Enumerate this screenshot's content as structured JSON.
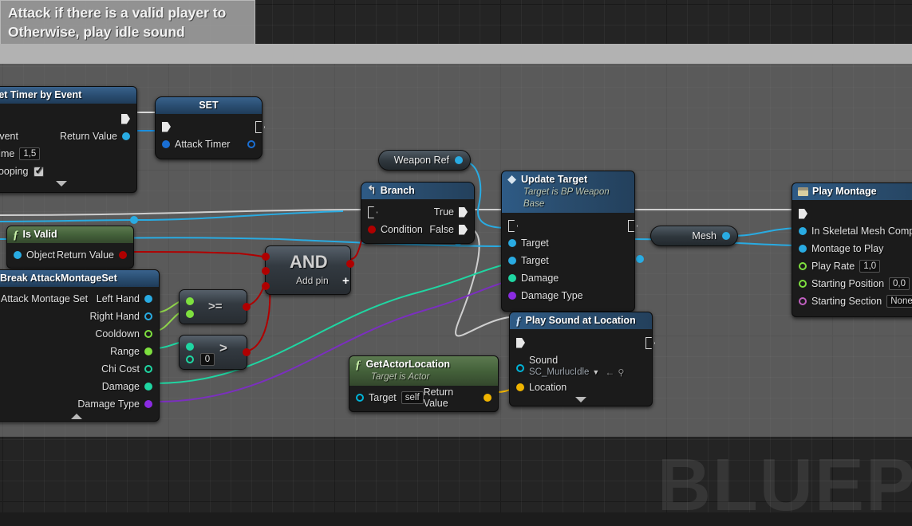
{
  "app": {
    "editor": "Unreal Engine Blueprint Graph",
    "watermark": "BLUEP"
  },
  "comments": {
    "top_region": {
      "title": ""
    },
    "attack": {
      "line1": "Attack if there is a valid player to",
      "line2": "Otherwise, play idle sound"
    }
  },
  "nodes": {
    "set_timer": {
      "title": "Set Timer by Event",
      "in_exec": "",
      "out_exec": "",
      "event_label": "Event",
      "return_label": "Return Value",
      "time_label": "Time",
      "time_value": "1,5",
      "looping_label": "Looping",
      "looping_checked": true
    },
    "set": {
      "title": "SET",
      "var_label": "Attack Timer"
    },
    "is_valid": {
      "title": "Is Valid",
      "icon": "f-icon",
      "object_label": "Object",
      "return_label": "Return Value"
    },
    "break_montage": {
      "title": "Break AttackMontageSet",
      "input_label": "Attack Montage Set",
      "outputs": [
        {
          "label": "Left Hand",
          "color": "#29abe2",
          "style": "solid"
        },
        {
          "label": "Right Hand",
          "color": "#29abe2",
          "style": "hollow"
        },
        {
          "label": "Cooldown",
          "color": "#7ee03f",
          "style": "hollow"
        },
        {
          "label": "Range",
          "color": "#7ee03f",
          "style": "solid"
        },
        {
          "label": "Chi Cost",
          "color": "#1fd6a2",
          "style": "hollow"
        },
        {
          "label": "Damage",
          "color": "#1fd6a2",
          "style": "solid"
        },
        {
          "label": "Damage Type",
          "color": "#8a2be2",
          "style": "solid"
        }
      ]
    },
    "cmp_gte": {
      "label": ">="
    },
    "cmp_gt": {
      "label": ">",
      "value": "0"
    },
    "and_node": {
      "label": "AND",
      "addpin_label": "Add pin",
      "addpin_icon": "plus-icon"
    },
    "weapon_ref": {
      "label": "Weapon Ref"
    },
    "mesh_ref": {
      "label": "Mesh"
    },
    "branch": {
      "title": "Branch",
      "condition_label": "Condition",
      "true_label": "True",
      "false_label": "False"
    },
    "update_target": {
      "title": "Update Target",
      "subtitle": "Target is BP Weapon Base",
      "inputs": [
        {
          "label": "Target",
          "color": "#29abe2",
          "style": "solid"
        },
        {
          "label": "Target",
          "color": "#29abe2",
          "style": "solid"
        },
        {
          "label": "Damage",
          "color": "#1fd6a2",
          "style": "solid"
        },
        {
          "label": "Damage Type",
          "color": "#8a2be2",
          "style": "solid"
        }
      ]
    },
    "get_actor_location": {
      "title": "GetActorLocation",
      "subtitle": "Target is Actor",
      "target_label": "Target",
      "target_value": "self",
      "return_label": "Return Value"
    },
    "play_sound": {
      "title": "Play Sound at Location",
      "sound_label": "Sound",
      "sound_value": "SC_MurlucIdle",
      "location_label": "Location"
    },
    "play_montage": {
      "title": "Play Montage",
      "rows": [
        {
          "label": "In Skeletal Mesh Componen",
          "color": "#29abe2",
          "style": "solid",
          "value": null
        },
        {
          "label": "Montage to Play",
          "color": "#29abe2",
          "style": "solid",
          "value": null
        },
        {
          "label": "Play Rate",
          "color": "#7ee03f",
          "style": "hollow",
          "value": "1,0"
        },
        {
          "label": "Starting Position",
          "color": "#7ee03f",
          "style": "hollow",
          "value": "0,0"
        },
        {
          "label": "Starting Section",
          "color": "#c060c0",
          "style": "hollow",
          "value": "None"
        }
      ]
    }
  }
}
